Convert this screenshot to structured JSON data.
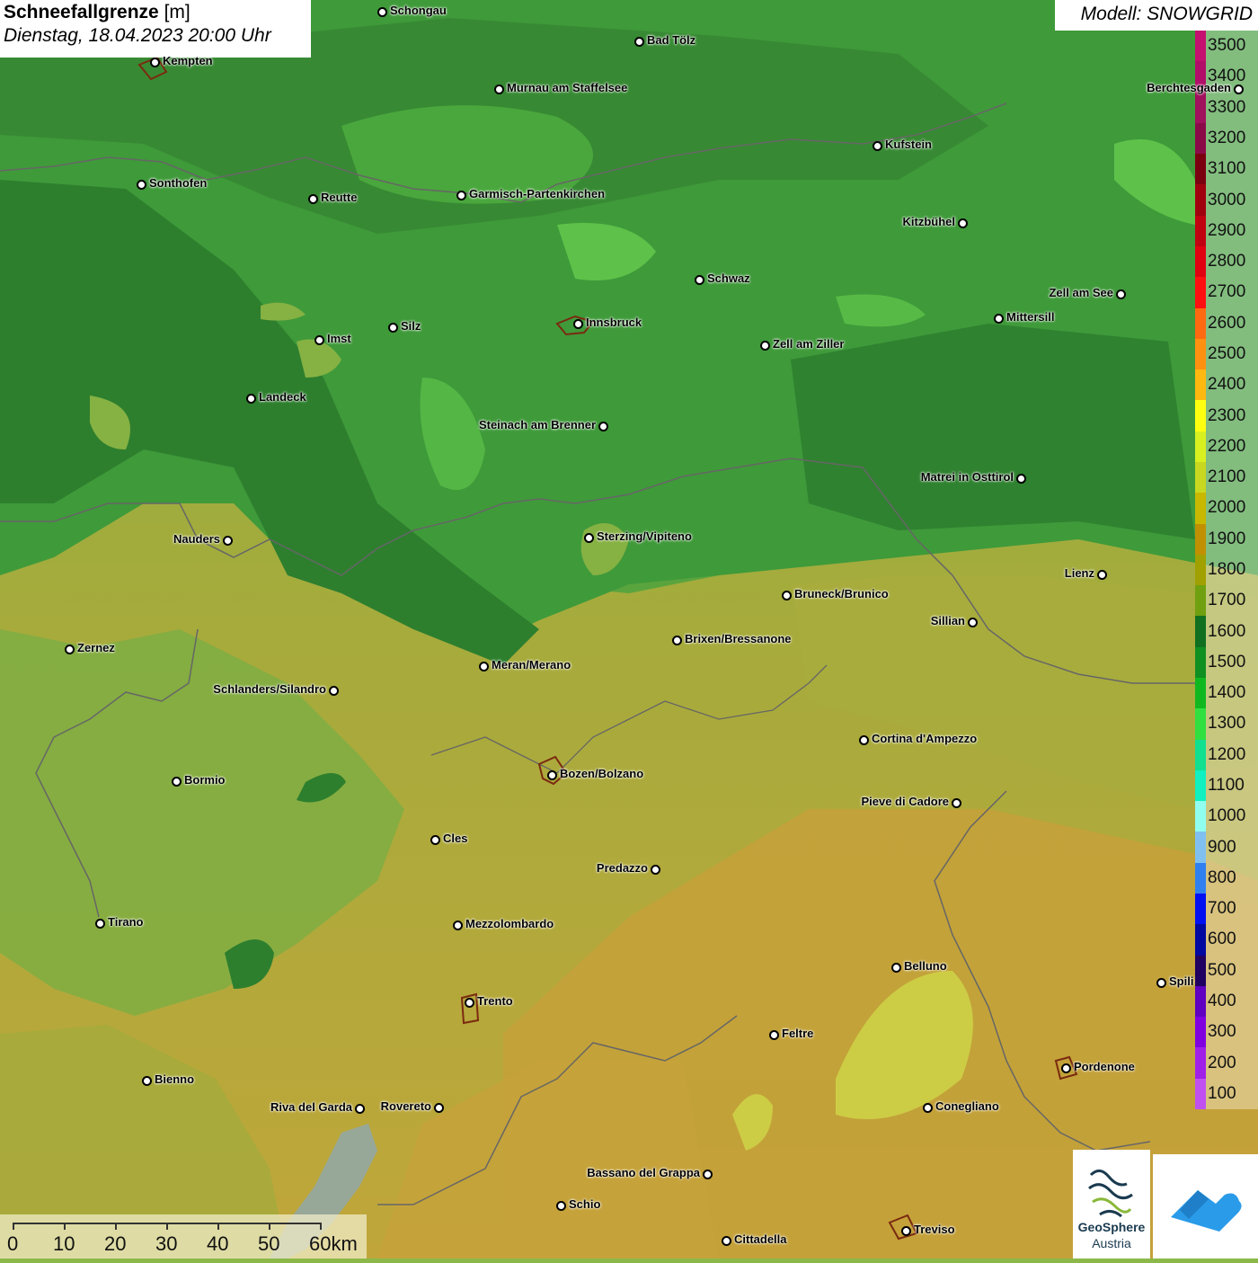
{
  "title": {
    "main": "Schneefallgrenze",
    "unit": "[m]",
    "date": "Dienstag, 18.04.2023 20:00 Uhr"
  },
  "model_label": "Modell: SNOWGRID",
  "legend": [
    {
      "label": "3500",
      "color": "#c4106e"
    },
    {
      "label": "3400",
      "color": "#b00e68"
    },
    {
      "label": "3300",
      "color": "#a0105c"
    },
    {
      "label": "3200",
      "color": "#8a0a48"
    },
    {
      "label": "3100",
      "color": "#7a0010"
    },
    {
      "label": "3000",
      "color": "#a0000e"
    },
    {
      "label": "2900",
      "color": "#c00010"
    },
    {
      "label": "2800",
      "color": "#e00010"
    },
    {
      "label": "2700",
      "color": "#ff1010"
    },
    {
      "label": "2600",
      "color": "#ff6a10"
    },
    {
      "label": "2500",
      "color": "#ff9010"
    },
    {
      "label": "2400",
      "color": "#ffb810"
    },
    {
      "label": "2300",
      "color": "#ffff10"
    },
    {
      "label": "2200",
      "color": "#d8f020"
    },
    {
      "label": "2100",
      "color": "#c8d820"
    },
    {
      "label": "2000",
      "color": "#c8b800"
    },
    {
      "label": "1900",
      "color": "#c09000"
    },
    {
      "label": "1800",
      "color": "#a0a000"
    },
    {
      "label": "1700",
      "color": "#70a010"
    },
    {
      "label": "1600",
      "color": "#107020"
    },
    {
      "label": "1500",
      "color": "#109020"
    },
    {
      "label": "1400",
      "color": "#10b820"
    },
    {
      "label": "1300",
      "color": "#30e040"
    },
    {
      "label": "1200",
      "color": "#10e090"
    },
    {
      "label": "1100",
      "color": "#10f0c0"
    },
    {
      "label": "1000",
      "color": "#90fff0"
    },
    {
      "label": "900",
      "color": "#80c0f0"
    },
    {
      "label": "800",
      "color": "#3080f0"
    },
    {
      "label": "700",
      "color": "#0010f0"
    },
    {
      "label": "600",
      "color": "#0008a0"
    },
    {
      "label": "500",
      "color": "#200060"
    },
    {
      "label": "400",
      "color": "#6000c0"
    },
    {
      "label": "300",
      "color": "#8000e0"
    },
    {
      "label": "200",
      "color": "#a020e8"
    },
    {
      "label": "100",
      "color": "#c050f0"
    }
  ],
  "cities": [
    {
      "name": "Schongau",
      "side": "right"
    },
    {
      "name": "Bad Tölz",
      "side": "right"
    },
    {
      "name": "Kempten",
      "side": "right"
    },
    {
      "name": "Murnau am Staffelsee",
      "side": "right"
    },
    {
      "name": "Berchtesgaden",
      "side": "left"
    },
    {
      "name": "Kufstein",
      "side": "right"
    },
    {
      "name": "Sonthofen",
      "side": "right"
    },
    {
      "name": "Reutte",
      "side": "right"
    },
    {
      "name": "Garmisch-Partenkirchen",
      "side": "right"
    },
    {
      "name": "Kitzbühel",
      "side": "left"
    },
    {
      "name": "Schwaz",
      "side": "right"
    },
    {
      "name": "Zell am See",
      "side": "left"
    },
    {
      "name": "Mittersill",
      "side": "right"
    },
    {
      "name": "Innsbruck",
      "side": "right"
    },
    {
      "name": "Silz",
      "side": "right"
    },
    {
      "name": "Imst",
      "side": "right"
    },
    {
      "name": "Zell am Ziller",
      "side": "right"
    },
    {
      "name": "Landeck",
      "side": "right"
    },
    {
      "name": "Steinach am Brenner",
      "side": "left"
    },
    {
      "name": "Matrei in Osttirol",
      "side": "left"
    },
    {
      "name": "Nauders",
      "side": "left"
    },
    {
      "name": "Sterzing/Vipiteno",
      "side": "right"
    },
    {
      "name": "Lienz",
      "side": "left"
    },
    {
      "name": "Bruneck/Brunico",
      "side": "right"
    },
    {
      "name": "Sillian",
      "side": "left"
    },
    {
      "name": "Brixen/Bressanone",
      "side": "right"
    },
    {
      "name": "Zernez",
      "side": "right"
    },
    {
      "name": "Meran/Merano",
      "side": "right"
    },
    {
      "name": "Schlanders/Silandro",
      "side": "left"
    },
    {
      "name": "Cortina d'Ampezzo",
      "side": "right"
    },
    {
      "name": "Bozen/Bolzano",
      "side": "right"
    },
    {
      "name": "Bormio",
      "side": "right"
    },
    {
      "name": "Pieve di Cadore",
      "side": "left"
    },
    {
      "name": "Cles",
      "side": "right"
    },
    {
      "name": "Predazzo",
      "side": "left"
    },
    {
      "name": "Tirano",
      "side": "right"
    },
    {
      "name": "Mezzolombardo",
      "side": "right"
    },
    {
      "name": "Belluno",
      "side": "right"
    },
    {
      "name": "Spili",
      "side": "right"
    },
    {
      "name": "Trento",
      "side": "right"
    },
    {
      "name": "Feltre",
      "side": "right"
    },
    {
      "name": "Pordenone",
      "side": "right"
    },
    {
      "name": "Bienno",
      "side": "right"
    },
    {
      "name": "Riva del Garda",
      "side": "left"
    },
    {
      "name": "Rovereto",
      "side": "left"
    },
    {
      "name": "Conegliano",
      "side": "right"
    },
    {
      "name": "Bassano del Grappa",
      "side": "left"
    },
    {
      "name": "Schio",
      "side": "right"
    },
    {
      "name": "Treviso",
      "side": "right"
    },
    {
      "name": "Cittadella",
      "side": "right"
    }
  ],
  "scale_bar": {
    "labels": [
      "0",
      "10",
      "20",
      "30",
      "40",
      "50",
      "60km"
    ]
  },
  "logo": {
    "line1": "GeoSphere",
    "line2": "Austria"
  },
  "colors": {
    "zone_1500": "#3f9a3a",
    "zone_1600": "#2d7f2e",
    "zone_1400": "#5ec24a",
    "zone_1700": "#86b243",
    "zone_1800": "#a6ab3c",
    "zone_1900": "#c0a63a",
    "zone_2000": "#c8b840",
    "zone_2200": "#cfd848"
  }
}
